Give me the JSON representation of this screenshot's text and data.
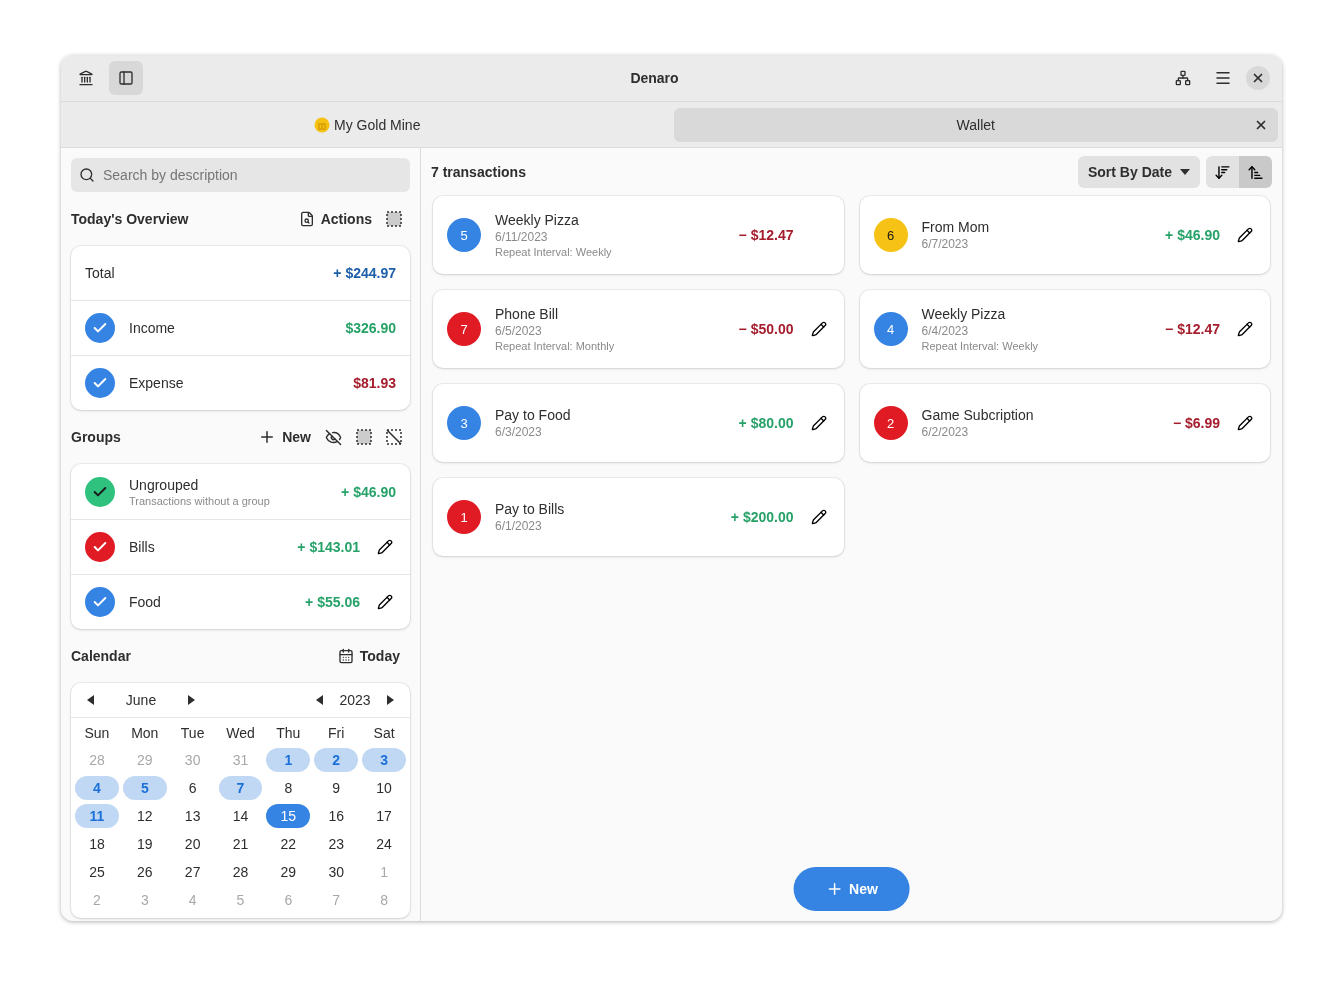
{
  "window": {
    "title": "Denaro"
  },
  "tabs": [
    {
      "label": "My Gold Mine",
      "selected": false,
      "icon": true
    },
    {
      "label": "Wallet",
      "selected": true,
      "icon": false
    }
  ],
  "search": {
    "placeholder": "Search by description"
  },
  "overview": {
    "title": "Today's Overview",
    "actions": "Actions",
    "rows": [
      {
        "kind": "total",
        "label": "Total",
        "amount": "+ $244.97"
      },
      {
        "kind": "income",
        "label": "Income",
        "amount": "$326.90",
        "checked": true
      },
      {
        "kind": "expense",
        "label": "Expense",
        "amount": "$81.93",
        "checked": true
      }
    ]
  },
  "groups": {
    "title": "Groups",
    "new": "New",
    "items": [
      {
        "name": "Ungrouped",
        "description": "Transactions without a group",
        "amount": "+ $46.90",
        "color": "#2ec27e",
        "checked": true,
        "editable": false
      },
      {
        "name": "Bills",
        "amount": "+ $143.01",
        "color": "#e01b24",
        "checked": true,
        "editable": true
      },
      {
        "name": "Food",
        "amount": "+ $55.06",
        "color": "#3584e4",
        "checked": true,
        "editable": true
      }
    ]
  },
  "calendar": {
    "title": "Calendar",
    "today": "Today",
    "month": "June",
    "year": "2023",
    "weekdays": [
      "Sun",
      "Mon",
      "Tue",
      "Wed",
      "Thu",
      "Fri",
      "Sat"
    ],
    "days": [
      {
        "label": "28",
        "outside": true,
        "marked": false,
        "selected": false
      },
      {
        "label": "29",
        "outside": true,
        "marked": false,
        "selected": false
      },
      {
        "label": "30",
        "outside": true,
        "marked": false,
        "selected": false
      },
      {
        "label": "31",
        "outside": true,
        "marked": false,
        "selected": false
      },
      {
        "label": "1",
        "outside": false,
        "marked": true,
        "selected": false
      },
      {
        "label": "2",
        "outside": false,
        "marked": true,
        "selected": false
      },
      {
        "label": "3",
        "outside": false,
        "marked": true,
        "selected": false
      },
      {
        "label": "4",
        "outside": false,
        "marked": true,
        "selected": false
      },
      {
        "label": "5",
        "outside": false,
        "marked": true,
        "selected": false
      },
      {
        "label": "6",
        "outside": false,
        "marked": false,
        "selected": false
      },
      {
        "label": "7",
        "outside": false,
        "marked": true,
        "selected": false
      },
      {
        "label": "8",
        "outside": false,
        "marked": false,
        "selected": false
      },
      {
        "label": "9",
        "outside": false,
        "marked": false,
        "selected": false
      },
      {
        "label": "10",
        "outside": false,
        "marked": false,
        "selected": false
      },
      {
        "label": "11",
        "outside": false,
        "marked": true,
        "selected": false
      },
      {
        "label": "12",
        "outside": false,
        "marked": false,
        "selected": false
      },
      {
        "label": "13",
        "outside": false,
        "marked": false,
        "selected": false
      },
      {
        "label": "14",
        "outside": false,
        "marked": false,
        "selected": false
      },
      {
        "label": "15",
        "outside": false,
        "marked": false,
        "selected": true
      },
      {
        "label": "16",
        "outside": false,
        "marked": false,
        "selected": false
      },
      {
        "label": "17",
        "outside": false,
        "marked": false,
        "selected": false
      },
      {
        "label": "18",
        "outside": false,
        "marked": false,
        "selected": false
      },
      {
        "label": "19",
        "outside": false,
        "marked": false,
        "selected": false
      },
      {
        "label": "20",
        "outside": false,
        "marked": false,
        "selected": false
      },
      {
        "label": "21",
        "outside": false,
        "marked": false,
        "selected": false
      },
      {
        "label": "22",
        "outside": false,
        "marked": false,
        "selected": false
      },
      {
        "label": "23",
        "outside": false,
        "marked": false,
        "selected": false
      },
      {
        "label": "24",
        "outside": false,
        "marked": false,
        "selected": false
      },
      {
        "label": "25",
        "outside": false,
        "marked": false,
        "selected": false
      },
      {
        "label": "26",
        "outside": false,
        "marked": false,
        "selected": false
      },
      {
        "label": "27",
        "outside": false,
        "marked": false,
        "selected": false
      },
      {
        "label": "28",
        "outside": false,
        "marked": false,
        "selected": false
      },
      {
        "label": "29",
        "outside": false,
        "marked": false,
        "selected": false
      },
      {
        "label": "30",
        "outside": false,
        "marked": false,
        "selected": false
      },
      {
        "label": "1",
        "outside": true,
        "marked": false,
        "selected": false
      },
      {
        "label": "2",
        "outside": true,
        "marked": false,
        "selected": false
      },
      {
        "label": "3",
        "outside": true,
        "marked": false,
        "selected": false
      },
      {
        "label": "4",
        "outside": true,
        "marked": false,
        "selected": false
      },
      {
        "label": "5",
        "outside": true,
        "marked": false,
        "selected": false
      },
      {
        "label": "6",
        "outside": true,
        "marked": false,
        "selected": false
      },
      {
        "label": "7",
        "outside": true,
        "marked": false,
        "selected": false
      },
      {
        "label": "8",
        "outside": true,
        "marked": false,
        "selected": false
      }
    ]
  },
  "transactions": {
    "count": "7 transactions",
    "sort": "Sort By Date",
    "sort_buttons": [
      {
        "selected": false
      },
      {
        "selected": true
      }
    ],
    "items": [
      {
        "id": "5",
        "color": "#3584e4",
        "name": "Weekly Pizza",
        "date": "6/11/2023",
        "repeat": "Repeat Interval: Weekly",
        "amount": "− $12.47",
        "expense": true,
        "editable": false
      },
      {
        "id": "6",
        "color": "#f6c215",
        "name": "From Mom",
        "date": "6/7/2023",
        "amount": "+ $46.90",
        "expense": false,
        "editable": true
      },
      {
        "id": "7",
        "color": "#e01b24",
        "name": "Phone Bill",
        "date": "6/5/2023",
        "repeat": "Repeat Interval: Monthly",
        "amount": "− $50.00",
        "expense": true,
        "editable": true
      },
      {
        "id": "4",
        "color": "#3584e4",
        "name": "Weekly Pizza",
        "date": "6/4/2023",
        "repeat": "Repeat Interval: Weekly",
        "amount": "− $12.47",
        "expense": true,
        "editable": true
      },
      {
        "id": "3",
        "color": "#3584e4",
        "name": "Pay to Food",
        "date": "6/3/2023",
        "amount": "+ $80.00",
        "expense": false,
        "editable": true
      },
      {
        "id": "2",
        "color": "#e01b24",
        "name": "Game Subcription",
        "date": "6/2/2023",
        "amount": "− $6.99",
        "expense": true,
        "editable": true
      },
      {
        "id": "1",
        "color": "#e01b24",
        "name": "Pay to Bills",
        "date": "6/1/2023",
        "amount": "+ $200.00",
        "expense": false,
        "editable": true
      }
    ]
  },
  "new_button": "New"
}
